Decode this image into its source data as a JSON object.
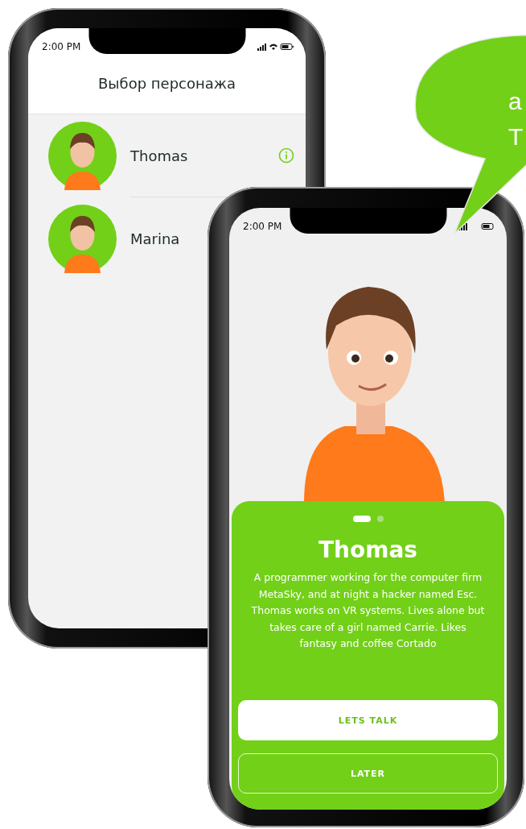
{
  "list_phone": {
    "status_time": "2:00 PM",
    "title": "Выбор персонажа",
    "characters": [
      {
        "name": "Thomas"
      },
      {
        "name": "Marina"
      }
    ]
  },
  "detail_phone": {
    "status_time": "2:00 PM",
    "name": "Thomas",
    "description": "A programmer working for the computer firm MetaSky, and at night a hacker named Esc. Thomas works on VR systems. Lives alone but takes care of a girl named Carrie. Likes fantasy and coffee Cortado",
    "pager": [
      {
        "selected": true
      },
      {
        "selected": false
      }
    ],
    "buttons": [
      {
        "label": "LETS TALK",
        "kind": "filled"
      },
      {
        "label": "LATER",
        "kind": "outline"
      }
    ]
  },
  "speech_bubble": {
    "lines": [
      "a",
      "T"
    ]
  }
}
